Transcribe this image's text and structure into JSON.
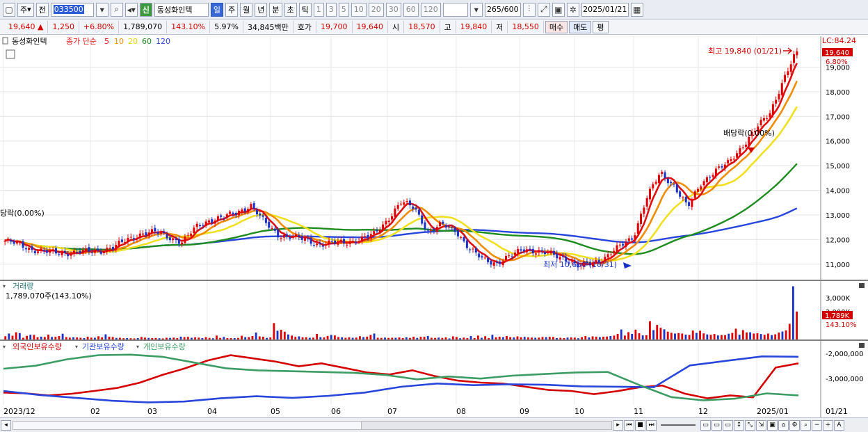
{
  "toolbar": {
    "unit": "주",
    "mode": "전",
    "code": "033500",
    "badge": "신",
    "name": "동성화인텍",
    "periods": [
      "일",
      "주",
      "월",
      "년",
      "분",
      "초",
      "틱"
    ],
    "ticks": [
      "1",
      "3",
      "5",
      "10",
      "20",
      "30",
      "60",
      "120"
    ],
    "count": "265/600",
    "date": "2025/01/21"
  },
  "quote": {
    "price": "19,640 ▲",
    "change": "1,250",
    "change_pct": "+6.80%",
    "volume": "1,789,070",
    "volume_ratio": "143.10%",
    "turnover": "5.97%",
    "amount": "34,845백만",
    "bid_label": "호가",
    "bid1": "19,700",
    "bid2": "19,640",
    "open_label": "시",
    "open": "18,570",
    "high_label": "고",
    "high": "19,840",
    "low_label": "저",
    "low": "18,550",
    "buy": "매수",
    "sell": "매도",
    "avg": "평"
  },
  "legend": {
    "stock": "동성화인텍",
    "ma_label": "종가 단순",
    "ma_periods": [
      "5",
      "10",
      "20",
      "60",
      "120"
    ]
  },
  "colors": {
    "candle_up": "#e00000",
    "candle_down": "#1a32c8",
    "ma5": "#e01010",
    "ma10": "#f08c00",
    "ma20": "#f0e020",
    "ma60": "#1e8c1e",
    "ma120": "#2846dc",
    "foreign": "#d40000",
    "institution": "#2846dc",
    "individual": "#3c9c64"
  },
  "chart_data": [
    {
      "type": "candlestick",
      "x_labels": [
        "2023/12",
        "02",
        "03",
        "04",
        "05",
        "06",
        "07",
        "08",
        "09",
        "10",
        "11",
        "12",
        "2025/01",
        "01/21"
      ],
      "y_ticks": [
        "19,000",
        "18,000",
        "17,000",
        "16,000",
        "15,000",
        "14,000",
        "13,000",
        "12,000",
        "11,000"
      ],
      "ylim": [
        10400,
        20200
      ],
      "close_path": [
        11950,
        11800,
        11600,
        11500,
        11450,
        11480,
        11500,
        11550,
        11700,
        12000,
        12250,
        12300,
        12100,
        11900,
        12500,
        12800,
        12900,
        13100,
        13400,
        12700,
        12200,
        12100,
        12000,
        11800,
        11850,
        11900,
        12000,
        12200,
        12800,
        13500,
        13300,
        12300,
        12600,
        12400,
        11600,
        11200,
        11050,
        11300,
        11650,
        11500,
        11400,
        11250,
        10900,
        11050,
        11300,
        11700,
        12100,
        13700,
        14700,
        14200,
        13300,
        14300,
        14800,
        15100,
        15800,
        16500,
        17100,
        18500,
        19640
      ],
      "annotations": {
        "high": "최고 19,840 (01/21)",
        "low": "최저 10,660 (10/31)",
        "dividend_right": "배당락(0.00%)",
        "dividend_left": "당락(0.00%)",
        "lc": "LC:84.24",
        "last_price": "19,640",
        "last_change": "6.80%"
      }
    },
    {
      "type": "bar",
      "title": "거래량",
      "value_label": "1,789,070주(143.10%)",
      "y_ticks": [
        "3,000K",
        "2,000K"
      ],
      "last_label": "1,789K",
      "last_ratio": "143.10%",
      "ylim": [
        0,
        3600
      ],
      "series": [
        {
          "values": [
            210,
            380,
            240,
            460,
            410,
            110,
            230,
            300,
            290,
            140,
            180,
            160,
            310,
            160,
            170,
            220,
            370,
            150,
            120,
            140,
            130,
            110,
            90,
            180,
            120,
            110,
            210,
            140,
            330,
            180,
            160,
            100,
            110,
            80,
            90,
            80,
            70,
            90,
            160,
            120,
            100,
            90,
            100,
            80,
            70,
            110,
            100,
            120,
            90,
            180,
            150,
            170,
            110,
            140,
            120,
            90,
            150,
            100,
            80,
            250,
            100,
            160,
            90,
            90,
            90,
            100,
            240,
            150,
            150,
            220,
            440,
            200,
            180,
            100,
            130,
            1050,
            560,
            620,
            500,
            320,
            250,
            170,
            200,
            140,
            140,
            110,
            120,
            360,
            150,
            130,
            230,
            290,
            260,
            160,
            140,
            110,
            140,
            110,
            120,
            210,
            150,
            180,
            290,
            380,
            110,
            100,
            120,
            100,
            110,
            110,
            130,
            90,
            140,
            100,
            180,
            100,
            170,
            170,
            220,
            110,
            100,
            120,
            100,
            130,
            70,
            200,
            160,
            80,
            120,
            90,
            220,
            90,
            250,
            110,
            210,
            90,
            300,
            140,
            180,
            150,
            220,
            150,
            130,
            200,
            140,
            170,
            130,
            120,
            110,
            120,
            160,
            150,
            170,
            160,
            90,
            110,
            90,
            120,
            130,
            120,
            80,
            150,
            220,
            130,
            200,
            180,
            150,
            180,
            190,
            220,
            250,
            360,
            640,
            250,
            470,
            360,
            630,
            400,
            260,
            270,
            1170,
            600,
            930,
            750,
            650,
            500,
            430,
            380,
            410,
            380,
            310,
            290,
            570,
            420,
            560,
            390,
            320,
            300,
            350,
            260,
            280,
            280,
            370,
            420,
            690,
            300,
            600,
            450,
            460,
            380,
            400,
            350,
            300,
            380,
            280,
            330,
            440,
            510,
            580,
            1000,
            3400,
            1789
          ]
        }
      ]
    },
    {
      "type": "line",
      "legend": [
        "외국인보유수량",
        "기관보유수량",
        "개인보유수량"
      ],
      "y_ticks": [
        "-2,000,000",
        "-3,000,000"
      ],
      "ylim": [
        -4000000,
        -1800000
      ],
      "series": [
        {
          "name": "외국인보유수량",
          "values": [
            -3500000,
            -3550000,
            -3600000,
            -3550000,
            -3450000,
            -3300000,
            -3100000,
            -2800000,
            -2500000,
            -2200000,
            -2000000,
            -2100000,
            -2250000,
            -2450000,
            -2300000,
            -2500000,
            -2700000,
            -2750000,
            -2600000,
            -2850000,
            -3000000,
            -3100000,
            -3150000,
            -3250000,
            -3400000,
            -3450000,
            -3550000,
            -3450000,
            -3300000,
            -3200000,
            -3550000,
            -3750000,
            -3600000,
            -3700000,
            -2500000,
            -2300000
          ]
        },
        {
          "name": "기관보유수량",
          "values": [
            -3450000,
            -3600000,
            -3700000,
            -3850000,
            -3900000,
            -3850000,
            -3750000,
            -3650000,
            -3700000,
            -3650000,
            -3500000,
            -3250000,
            -3150000,
            -3200000,
            -3150000,
            -3200000,
            -3250000,
            -3250000,
            -3300000,
            -2400000,
            -2200000,
            -2050000,
            -2050000
          ]
        },
        {
          "name": "개인보유수량",
          "values": [
            -2550000,
            -2400000,
            -2150000,
            -2000000,
            -1950000,
            -2050000,
            -2300000,
            -2500000,
            -2600000,
            -2650000,
            -2650000,
            -2700000,
            -2800000,
            -2950000,
            -2850000,
            -2950000,
            -2800000,
            -2750000,
            -2700000,
            -2650000,
            -3200000,
            -3700000,
            -3800000,
            -3750000,
            -3550000,
            -3600000
          ]
        }
      ]
    }
  ]
}
